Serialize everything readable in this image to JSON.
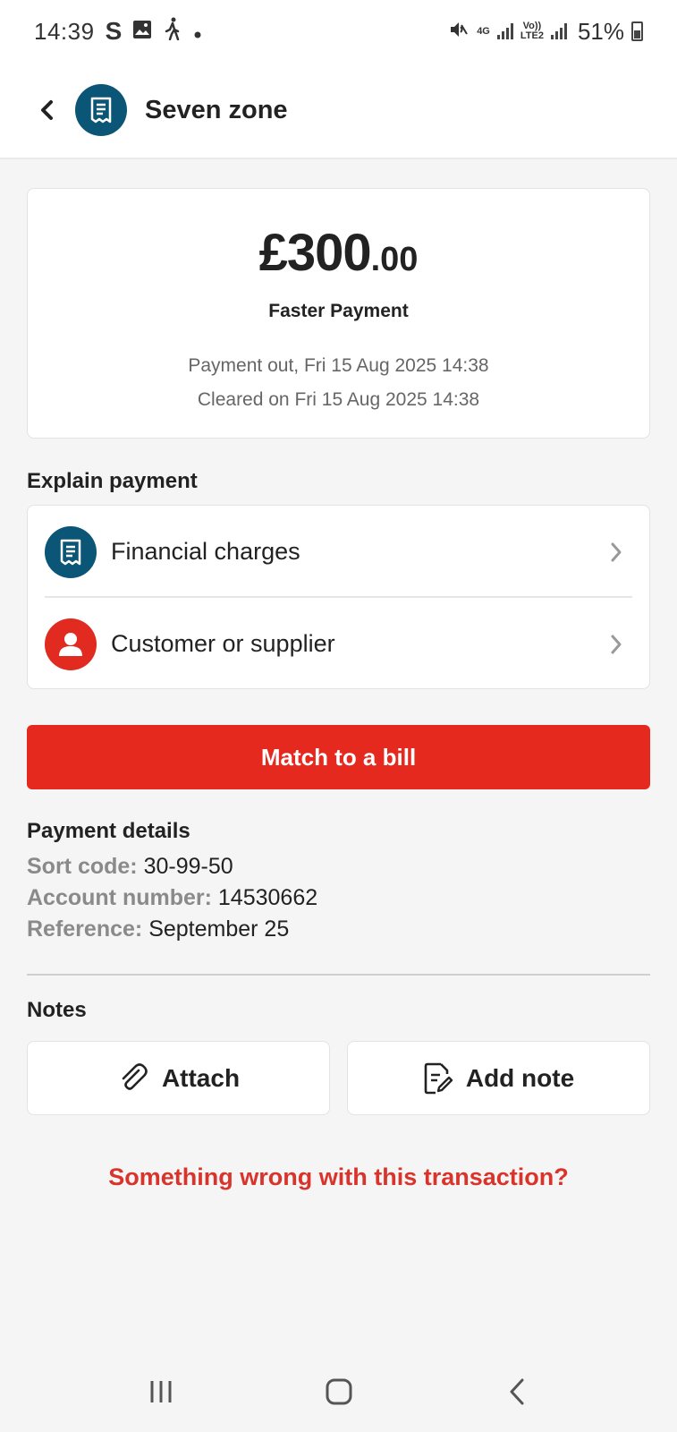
{
  "status_bar": {
    "time": "14:39",
    "left_icons": [
      "s-icon",
      "gallery-icon",
      "walking-icon",
      "dot-icon"
    ],
    "network_4g": "4G",
    "volte": "Vo))",
    "lte2": "LTE2",
    "battery": "51%"
  },
  "header": {
    "title": "Seven zone",
    "avatar_icon": "receipt-icon"
  },
  "transaction": {
    "amount_main": "£300",
    "amount_decimals": ".00",
    "type": "Faster Payment",
    "direction_date": "Payment out, Fri 15 Aug 2025 14:38",
    "cleared": "Cleared on Fri 15 Aug 2025 14:38"
  },
  "explain": {
    "title": "Explain payment",
    "items": [
      {
        "label": "Financial charges",
        "icon": "receipt-icon",
        "color": "#0b5577"
      },
      {
        "label": "Customer or supplier",
        "icon": "person-icon",
        "color": "#e12b21"
      }
    ]
  },
  "match_button": "Match to a bill",
  "payment_details": {
    "title": "Payment details",
    "sort_code_label": "Sort code:",
    "sort_code": "30-99-50",
    "account_label": "Account number:",
    "account": "14530662",
    "reference_label": "Reference:",
    "reference": "September 25"
  },
  "notes": {
    "title": "Notes",
    "attach": "Attach",
    "add_note": "Add note"
  },
  "wrong_link": "Something wrong with this transaction?",
  "colors": {
    "brand_red": "#e5291f",
    "brand_blue": "#0b5577",
    "background": "#f5f5f5"
  }
}
